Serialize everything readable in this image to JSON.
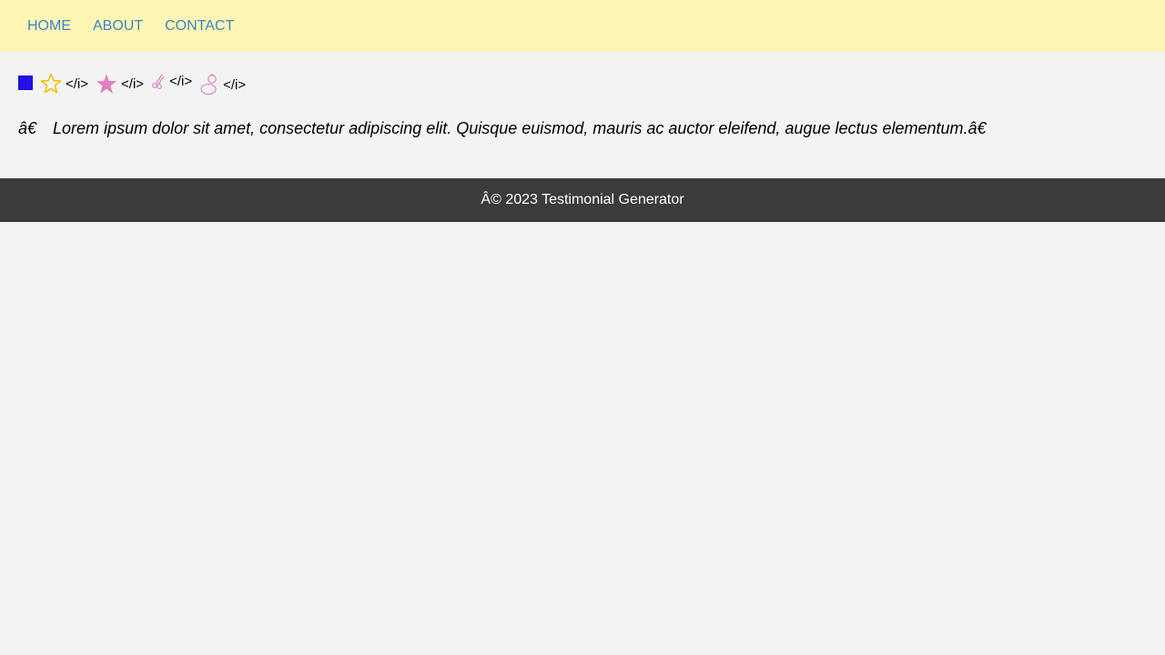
{
  "nav": {
    "items": [
      {
        "label": "HOME"
      },
      {
        "label": "ABOUT"
      },
      {
        "label": "CONTACT"
      }
    ]
  },
  "icons": {
    "tag_text": "</i>",
    "items": [
      {
        "name": "square-icon",
        "color": "#2211ee"
      },
      {
        "name": "star-outline-icon",
        "color": "#f2c200"
      },
      {
        "name": "star-filled-icon",
        "color": "#e07ec0"
      },
      {
        "name": "scissors-icon",
        "color": "#e07ec0"
      },
      {
        "name": "snowman-icon",
        "color": "#e07ec0"
      }
    ]
  },
  "testimonial": {
    "open_mark": "â€",
    "text": "Lorem ipsum dolor sit amet, consectetur adipiscing elit. Quisque euismod, mauris ac auctor eleifend, augue lectus elementum.â€"
  },
  "footer": {
    "text": "Â© 2023 Testimonial Generator"
  },
  "colors": {
    "nav_bg": "#fff5b5",
    "nav_link": "#3d84c4",
    "page_bg": "#f3f3f3",
    "footer_bg": "#3b3b3b"
  }
}
